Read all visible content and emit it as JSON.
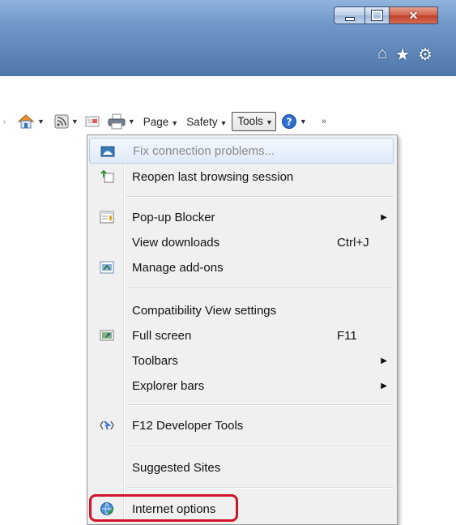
{
  "titlebar": {
    "minimize_glyph": "—",
    "maximize_glyph": "☐",
    "close_glyph": "✕"
  },
  "favorites_bar": {
    "home_icon": "⌂",
    "favorites_icon": "★",
    "tools_icon": "⚙"
  },
  "command_bar": {
    "page_label": "Page",
    "safety_label": "Safety",
    "tools_label": "Tools",
    "overflow_label": "»"
  },
  "menu": {
    "items": [
      {
        "label": "Fix connection problems...",
        "shortcut": "",
        "submenu": false,
        "icon": "network-icon",
        "disabled": true
      },
      {
        "label": "Reopen last browsing session",
        "shortcut": "",
        "submenu": false,
        "icon": "reopen-session-icon"
      },
      {
        "label": "Pop-up Blocker",
        "shortcut": "",
        "submenu": true,
        "icon": "popup-blocker-icon"
      },
      {
        "label": "View downloads",
        "shortcut": "Ctrl+J",
        "submenu": false,
        "icon": ""
      },
      {
        "label": "Manage add-ons",
        "shortcut": "",
        "submenu": false,
        "icon": "addons-icon"
      },
      {
        "label": "Compatibility View settings",
        "shortcut": "",
        "submenu": false,
        "icon": ""
      },
      {
        "label": "Full screen",
        "shortcut": "F11",
        "submenu": false,
        "icon": "fullscreen-icon"
      },
      {
        "label": "Toolbars",
        "shortcut": "",
        "submenu": true,
        "icon": ""
      },
      {
        "label": "Explorer bars",
        "shortcut": "",
        "submenu": true,
        "icon": ""
      },
      {
        "label": "F12 Developer Tools",
        "shortcut": "",
        "submenu": false,
        "icon": "developer-tools-icon"
      },
      {
        "label": "Suggested Sites",
        "shortcut": "",
        "submenu": false,
        "icon": ""
      },
      {
        "label": "Internet options",
        "shortcut": "",
        "submenu": false,
        "icon": "internet-options-icon"
      }
    ],
    "submenu_arrow": "▶"
  },
  "colors": {
    "highlight_ring": "#d0142a",
    "titlebar": "#4f77aa"
  }
}
